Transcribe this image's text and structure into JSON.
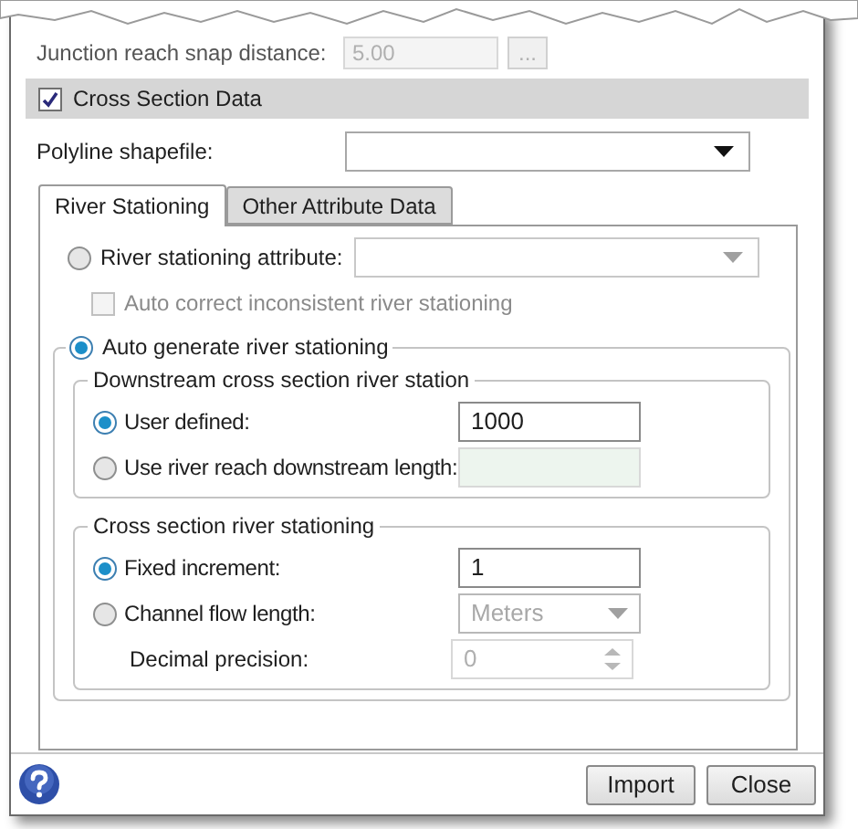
{
  "top_row": {
    "label": "Junction reach snap distance:",
    "value": "5.00",
    "button": "..."
  },
  "section": {
    "label": "Cross Section Data",
    "checked": true
  },
  "polyline": {
    "label": "Polyline shapefile:"
  },
  "tabs": [
    {
      "label": "River Stationing",
      "selected": true
    },
    {
      "label": "Other Attribute Data",
      "selected": false
    }
  ],
  "stationing_attribute": {
    "label": "River stationing attribute:",
    "selected": false
  },
  "auto_correct": {
    "label": "Auto correct inconsistent river stationing",
    "checked": false,
    "disabled": true
  },
  "auto_generate": {
    "label": "Auto generate river stationing",
    "selected": true
  },
  "downstream": {
    "title": "Downstream cross section river station",
    "options": [
      {
        "kind": "text",
        "label": "User defined:",
        "selected": true,
        "value": "1000"
      },
      {
        "kind": "readonly",
        "label": "Use river reach downstream length:",
        "selected": false
      }
    ]
  },
  "cross_section": {
    "title": "Cross section river stationing",
    "options": [
      {
        "kind": "text",
        "label": "Fixed increment:",
        "selected": true,
        "value": "1"
      },
      {
        "kind": "dropdown",
        "label": "Channel flow length:",
        "selected": false,
        "value": "Meters"
      }
    ],
    "decimal_precision": {
      "label": "Decimal precision:",
      "value": "0",
      "disabled": true
    }
  },
  "buttons": [
    "Import",
    "Close"
  ]
}
